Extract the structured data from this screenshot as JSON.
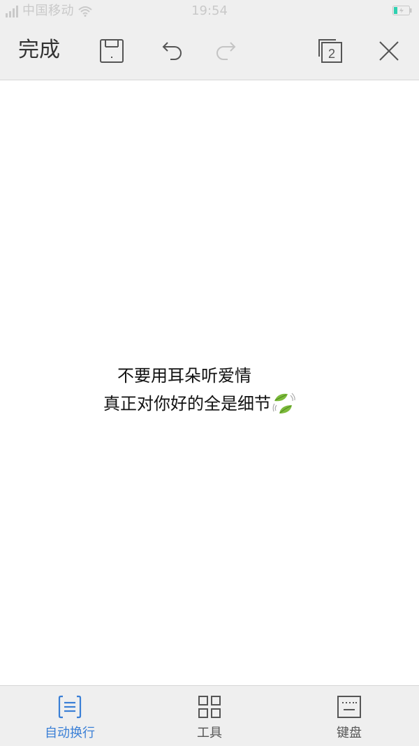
{
  "status_bar": {
    "carrier": "中国移动",
    "time": "19:54",
    "battery_color": "#2fd0b0"
  },
  "toolbar": {
    "done_label": "完成",
    "page_count": "2"
  },
  "document": {
    "lines": [
      "不要用耳朵听爱情",
      "真正对你好的全是细节"
    ]
  },
  "bottom_bar": {
    "tabs": [
      {
        "label": "自动换行",
        "active": true
      },
      {
        "label": "工具",
        "active": false
      },
      {
        "label": "键盘",
        "active": false
      }
    ]
  },
  "colors": {
    "accent": "#3a7fd6",
    "bar_background": "#efefef",
    "icon_gray": "#555555",
    "icon_disabled": "#c4c4c4"
  }
}
